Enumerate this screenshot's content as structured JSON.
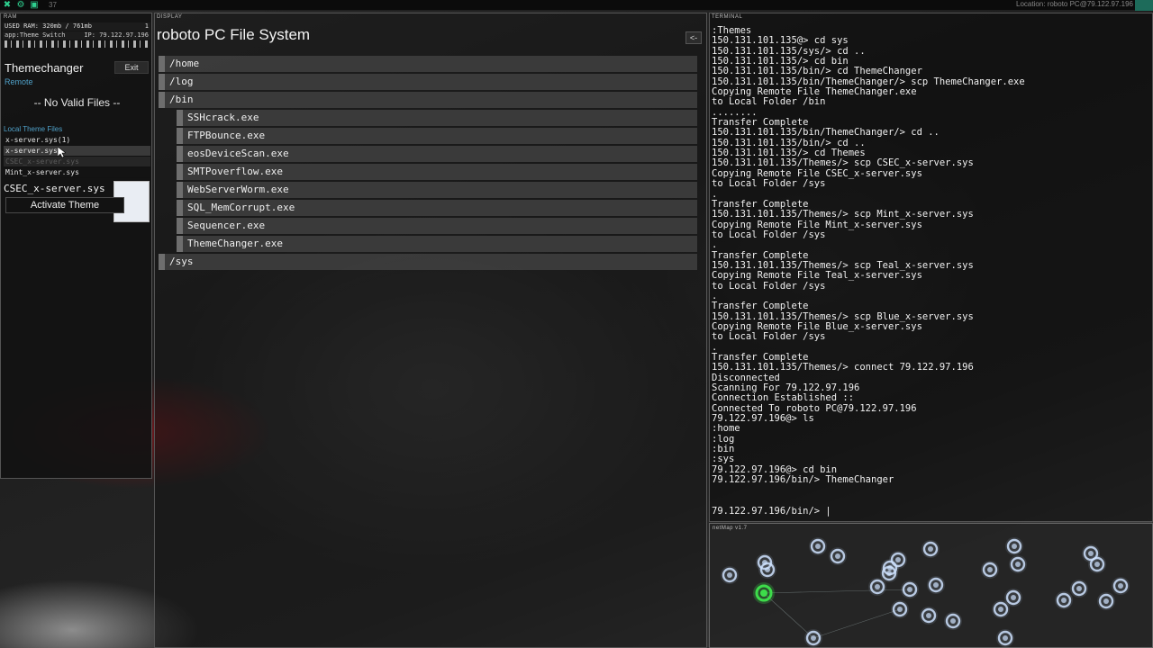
{
  "topbar": {
    "count": "37",
    "location": "Location: roboto PC@79.122.97.196",
    "icons": [
      "close-icon",
      "gear-icon",
      "folder-icon"
    ]
  },
  "ram_panel": {
    "label": "RAM",
    "used": "USED RAM: 320mb / 761mb",
    "process_count": "1",
    "app": "app:Theme Switch",
    "ip": "IP: 79.122.97.196"
  },
  "theme_changer": {
    "title": "Themechanger",
    "exit_label": "Exit",
    "remote_label": "Remote",
    "no_files": "-- No Valid Files --",
    "local_label": "Local Theme Files",
    "files": [
      {
        "name": "x-server.sys(1)",
        "state": "normal"
      },
      {
        "name": "x-server.sys",
        "state": "selected"
      },
      {
        "name": "CSEC_x-server.sys",
        "state": "dim"
      },
      {
        "name": "Mint_x-server.sys",
        "state": "normal"
      }
    ],
    "selected_file": "CSEC_x-server.sys",
    "activate_label": "Activate Theme"
  },
  "display": {
    "label": "DISPLAY",
    "title": "roboto PC File System",
    "back_label": "<-",
    "tree": [
      {
        "name": "/home",
        "depth": 0
      },
      {
        "name": "/log",
        "depth": 0
      },
      {
        "name": "/bin",
        "depth": 0
      },
      {
        "name": "SSHcrack.exe",
        "depth": 1
      },
      {
        "name": "FTPBounce.exe",
        "depth": 1
      },
      {
        "name": "eosDeviceScan.exe",
        "depth": 1
      },
      {
        "name": "SMTPoverflow.exe",
        "depth": 1
      },
      {
        "name": "WebServerWorm.exe",
        "depth": 1
      },
      {
        "name": "SQL_MemCorrupt.exe",
        "depth": 1
      },
      {
        "name": "Sequencer.exe",
        "depth": 1
      },
      {
        "name": "ThemeChanger.exe",
        "depth": 1
      },
      {
        "name": "/sys",
        "depth": 0
      }
    ]
  },
  "terminal": {
    "label": "TERMINAL",
    "lines": [
      ":Themes",
      "150.131.101.135@> cd sys",
      "150.131.101.135/sys/> cd ..",
      "150.131.101.135/> cd bin",
      "150.131.101.135/bin/> cd ThemeChanger",
      "150.131.101.135/bin/ThemeChanger/> scp ThemeChanger.exe",
      "Copying Remote File ThemeChanger.exe",
      "to Local Folder /bin",
      "........",
      "Transfer Complete",
      "150.131.101.135/bin/ThemeChanger/> cd ..",
      "150.131.101.135/bin/> cd ..",
      "150.131.101.135/> cd Themes",
      "150.131.101.135/Themes/> scp CSEC_x-server.sys",
      "Copying Remote File CSEC_x-server.sys",
      "to Local Folder /sys",
      ".",
      "Transfer Complete",
      "150.131.101.135/Themes/> scp Mint_x-server.sys",
      "Copying Remote File Mint_x-server.sys",
      "to Local Folder /sys",
      ".",
      "Transfer Complete",
      "150.131.101.135/Themes/> scp Teal_x-server.sys",
      "Copying Remote File Teal_x-server.sys",
      "to Local Folder /sys",
      ".",
      "Transfer Complete",
      "150.131.101.135/Themes/> scp Blue_x-server.sys",
      "Copying Remote File Blue_x-server.sys",
      "to Local Folder /sys",
      ".",
      "Transfer Complete",
      "150.131.101.135/Themes/> connect 79.122.97.196",
      "Disconnected",
      "Scanning For 79.122.97.196",
      "Connection Established ::",
      "Connected To roboto PC@79.122.97.196",
      "79.122.97.196@> ls",
      ":home",
      ":log",
      ":bin",
      ":sys",
      "79.122.97.196@> cd bin",
      "79.122.97.196/bin/> ThemeChanger"
    ],
    "prompt": "79.122.97.196/bin/> |"
  },
  "netmap": {
    "label": "netMap v1.7",
    "node_color": "#cfe3ff",
    "active_color": "#3ddc4a"
  }
}
